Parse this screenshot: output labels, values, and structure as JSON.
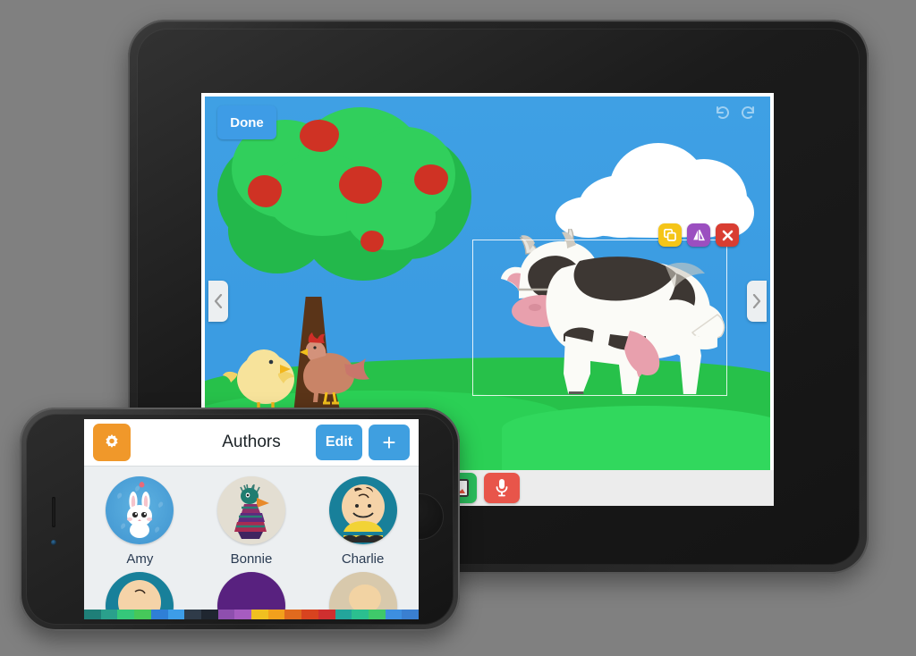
{
  "scene": {
    "background_color": "#808080",
    "devices": [
      "ipad",
      "iphone"
    ]
  },
  "ipad": {
    "device_name": "iPad",
    "orientation": "landscape",
    "bezel_color": "#1d1d1d",
    "camera_name": "front-camera",
    "home_button_name": "home-button",
    "app": {
      "canvas_title": "story-illustration-canvas",
      "done_label": "Done",
      "undo_icon": "undo-icon",
      "redo_icon": "redo-icon",
      "prev_page_icon": "chevron-left-icon",
      "next_page_icon": "chevron-right-icon",
      "sky_color": "#3b9ce2",
      "grass_color": "#27c14a",
      "tree": {
        "name": "apple-tree",
        "canopy_color": "#23b84b",
        "canopy_highlight": "#31cf5c",
        "trunk_color": "#5a3418",
        "apple_color": "#cf3224",
        "apple_count": 5
      },
      "cloud": {
        "name": "cloud",
        "color": "#ffffff"
      },
      "cow": {
        "name": "cow-sticker",
        "body_color": "#fbfbf7",
        "spot_color": "#3d3733",
        "snout_color": "#e8a0ad",
        "selected": true
      },
      "hen": {
        "name": "hen",
        "color": "#c98467"
      },
      "chick": {
        "name": "chick",
        "color": "#f7e39b"
      },
      "object_tools": [
        {
          "name": "duplicate-button",
          "icon": "duplicate-icon",
          "color": "#f5c518"
        },
        {
          "name": "flip-button",
          "icon": "flip-horizontal-icon",
          "color": "#9b4fc0"
        },
        {
          "name": "delete-button",
          "icon": "close-x-icon",
          "color": "#d93d32"
        }
      ],
      "toolbar": {
        "palette_name": "color-palette",
        "palette_more_icon": "chevron-right-icon",
        "swatches": [
          "#b9bfc2",
          "#eceff0",
          "#cb372c",
          "#e8543f",
          "#dd5f10",
          "#e8881f"
        ],
        "photo_button": {
          "label": "photo-button",
          "icon": "photo-frame-icon",
          "color": "#2bbd5c"
        },
        "mic_button": {
          "label": "record-button",
          "icon": "microphone-icon",
          "color": "#e8554a"
        }
      }
    }
  },
  "iphone": {
    "device_name": "iPhone",
    "orientation": "landscape",
    "bezel_color": "#202020",
    "app": {
      "settings_icon": "gear-icon",
      "settings_button_color": "#f0982a",
      "title": "Authors",
      "edit_label": "Edit",
      "add_label": "+",
      "authors": [
        {
          "name": "Amy",
          "avatar": "rabbit-avatar",
          "bg": "#4ba3d8"
        },
        {
          "name": "Bonnie",
          "avatar": "peacock-avatar",
          "bg": "#e3ded2"
        },
        {
          "name": "Charlie",
          "avatar": "charlie-brown-avatar",
          "bg": "#18809a"
        }
      ],
      "second_row_partial": [
        {
          "avatar": "charlie-brown-avatar",
          "bg": "#18809a"
        },
        {
          "avatar": "purple-avatar",
          "bg": "#58217f"
        },
        {
          "avatar": "beige-avatar",
          "bg": "#d8c9ac"
        }
      ],
      "rainbow_strip": [
        "#1f7f78",
        "#2aa08c",
        "#35c77a",
        "#46c85a",
        "#2f7fd6",
        "#3d9de8",
        "#2f3b49",
        "#1f2630",
        "#8e4fae",
        "#a65cc0",
        "#f0c020",
        "#f2a01c",
        "#e06a1e",
        "#d8431f",
        "#cf2f2f",
        "#23a59b",
        "#2bbf8f",
        "#3fc96a",
        "#3d8fe0",
        "#3a7fd0"
      ]
    }
  }
}
